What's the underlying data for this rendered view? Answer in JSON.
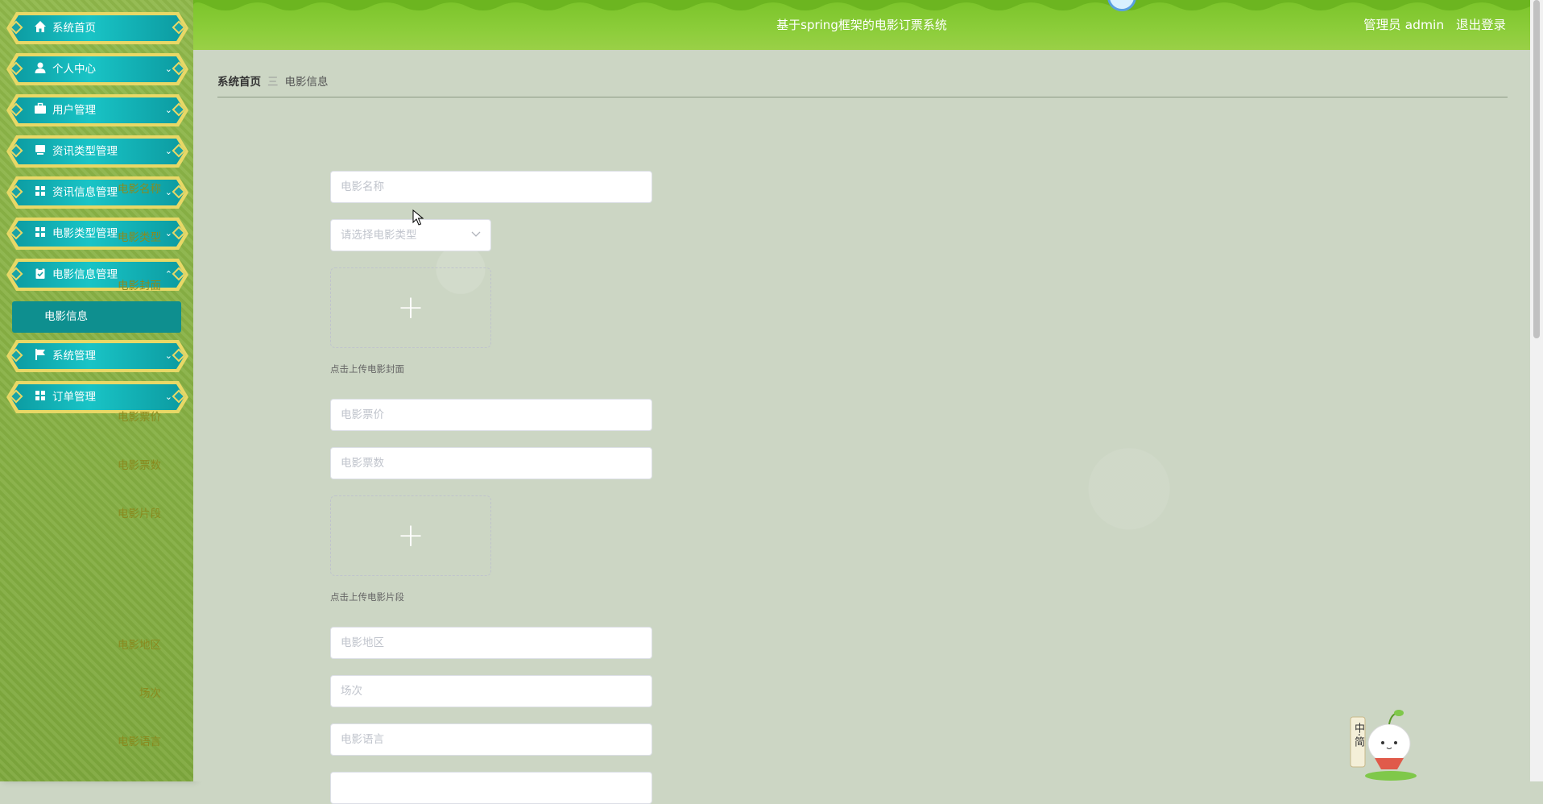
{
  "header": {
    "title": "基于spring框架的电影订票系统",
    "user_role": "管理员",
    "user_name": "admin",
    "logout": "退出登录"
  },
  "sidebar": {
    "items": [
      {
        "label": "系统首页",
        "icon": "home-icon"
      },
      {
        "label": "个人中心",
        "icon": "user-icon"
      },
      {
        "label": "用户管理",
        "icon": "briefcase-icon"
      },
      {
        "label": "资讯类型管理",
        "icon": "monitor-icon"
      },
      {
        "label": "资讯信息管理",
        "icon": "grid-icon"
      },
      {
        "label": "电影类型管理",
        "icon": "grid-icon"
      },
      {
        "label": "电影信息管理",
        "icon": "clipboard-icon"
      },
      {
        "label": "系统管理",
        "icon": "flag-icon"
      },
      {
        "label": "订单管理",
        "icon": "grid-icon"
      }
    ],
    "submenu": {
      "label": "电影信息"
    }
  },
  "breadcrumb": {
    "home": "系统首页",
    "separator": "三",
    "current": "电影信息"
  },
  "form": {
    "name": {
      "label": "电影名称",
      "placeholder": "电影名称"
    },
    "type": {
      "label": "电影类型",
      "placeholder": "请选择电影类型"
    },
    "cover": {
      "label": "电影封面",
      "hint": "点击上传电影封面"
    },
    "price": {
      "label": "电影票价",
      "placeholder": "电影票价"
    },
    "tickets": {
      "label": "电影票数",
      "placeholder": "电影票数"
    },
    "clip": {
      "label": "电影片段",
      "hint": "点击上传电影片段"
    },
    "region": {
      "label": "电影地区",
      "placeholder": "电影地区"
    },
    "session": {
      "label": "场次",
      "placeholder": "场次"
    },
    "language": {
      "label": "电影语言",
      "placeholder": "电影语言"
    }
  },
  "mascot": {
    "text": "中·简"
  },
  "colors": {
    "sidebar_bg": "#8fb84a",
    "menu_teal": "#19c4c6",
    "menu_gold": "#e8d866",
    "header_green": "#8ccd3a",
    "label_olive": "#8a8a1e"
  }
}
